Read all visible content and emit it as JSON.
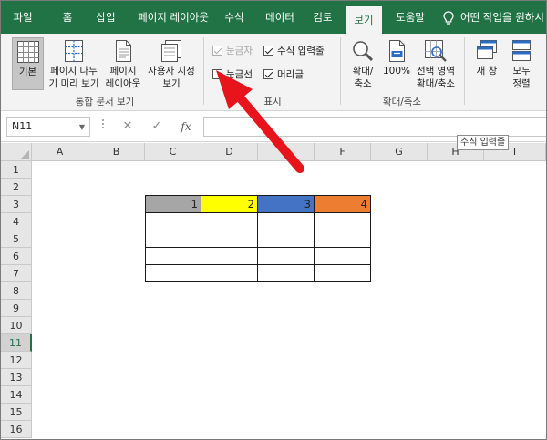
{
  "tabs": [
    {
      "label": "파일",
      "active": false
    },
    {
      "label": "홈",
      "active": false
    },
    {
      "label": "삽입",
      "active": false
    },
    {
      "label": "페이지 레이아웃",
      "active": false
    },
    {
      "label": "수식",
      "active": false
    },
    {
      "label": "데이터",
      "active": false
    },
    {
      "label": "검토",
      "active": false
    },
    {
      "label": "보기",
      "active": true
    },
    {
      "label": "도움말",
      "active": false
    }
  ],
  "tell_me": "어떤 작업을 원하시",
  "ribbon": {
    "workbook_views": {
      "normal": "기본",
      "page_break_line1": "페이지 나누",
      "page_break_line2": "기 미리 보기",
      "page_layout_line1": "페이지",
      "page_layout_line2": "레이아웃",
      "custom_views_line1": "사용자 지정",
      "custom_views_line2": "보기",
      "group_label": "통합 문서 보기"
    },
    "show": {
      "ruler": {
        "label": "눈금자",
        "checked": true,
        "disabled": true
      },
      "formula_bar": {
        "label": "수식 입력줄",
        "checked": true
      },
      "gridlines": {
        "label": "눈금선",
        "checked": false
      },
      "headings": {
        "label": "머리글",
        "checked": true
      },
      "group_label": "표시"
    },
    "zoom": {
      "zoom_line1": "확대/",
      "zoom_line2": "축소",
      "hundred": "100%",
      "zoom_sel_line1": "선택 영역",
      "zoom_sel_line2": "확대/축소",
      "group_label": "확대/축소"
    },
    "window": {
      "new_window": "새 창",
      "arrange_line1": "모두",
      "arrange_line2": "정렬"
    }
  },
  "formula_bar": {
    "name_box": "N11",
    "cancel_icon": "✕",
    "enter_icon": "✓",
    "fx": "fx",
    "value": ""
  },
  "tooltip": "수식 입력줄",
  "columns": [
    "A",
    "B",
    "C",
    "D",
    "E",
    "F",
    "G",
    "H",
    "I"
  ],
  "rows": [
    "1",
    "2",
    "3",
    "4",
    "5",
    "6",
    "7",
    "8",
    "9",
    "10",
    "11",
    "12",
    "13",
    "14",
    "15",
    "16"
  ],
  "selected_row": "11",
  "table": {
    "header_values": [
      "1",
      "2",
      "3",
      "4"
    ],
    "header_colors": [
      "#a6a6a6",
      "#ffff00",
      "#4472c4",
      "#ed7d31"
    ]
  },
  "colors": {
    "ribbon_green": "#217346",
    "arrow_red": "#e8141b"
  }
}
